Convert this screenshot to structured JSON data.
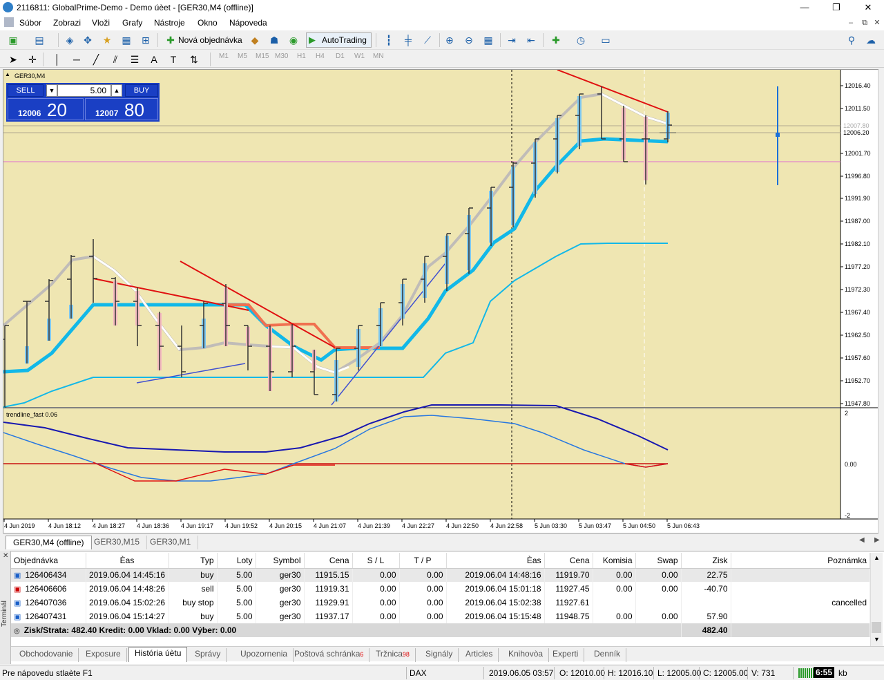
{
  "window": {
    "title": "2116811: GlobalPrime-Demo - Demo úèet - [GER30,M4 (offline)]",
    "minimize": "—",
    "restore": "❐",
    "close": "✕"
  },
  "menu": [
    "Súbor",
    "Zobrazi",
    "Vloži",
    "Grafy",
    "Nástroje",
    "Okno",
    "Nápoveda"
  ],
  "toolbar": {
    "new_order": "Nová objednávka",
    "autotrading": "AutoTrading",
    "timeframes": [
      "M1",
      "M5",
      "M15",
      "M30",
      "H1",
      "H4",
      "D1",
      "W1",
      "MN"
    ]
  },
  "chart": {
    "symbol_label": "GER30,M4",
    "indicator_label": "trendline_fast 0.06",
    "trade": {
      "sell_label": "SELL",
      "buy_label": "BUY",
      "lots": "5.00",
      "sell_price_small": "12006",
      "sell_price_big": "20",
      "buy_price_small": "12007",
      "buy_price_big": "80"
    },
    "price_axis": [
      "12016.40",
      "12011.50",
      "12006.20",
      "12001.70",
      "11996.80",
      "11991.90",
      "11987.00",
      "11982.10",
      "11977.20",
      "11972.30",
      "11967.40",
      "11962.50",
      "11957.60",
      "11952.70",
      "11947.80"
    ],
    "bid_tag": "12006.20",
    "ask_tag": "12007.80",
    "indicator_axis": [
      "2",
      "0.00",
      "-2"
    ],
    "time_axis": [
      "4 Jun 2019",
      "4 Jun 18:12",
      "4 Jun 18:27",
      "4 Jun 18:36",
      "4 Jun 19:17",
      "4 Jun 19:52",
      "4 Jun 20:15",
      "4 Jun 21:07",
      "4 Jun 21:39",
      "4 Jun 22:27",
      "4 Jun 22:50",
      "4 Jun 22:58",
      "5 Jun 03:30",
      "5 Jun 03:47",
      "5 Jun 04:50",
      "5 Jun 06:43"
    ]
  },
  "chart_tabs": [
    "GER30,M4 (offline)",
    "GER30,M15",
    "GER30,M1"
  ],
  "terminal": {
    "side_label": "Terminál",
    "columns": [
      "Objednávka",
      "Èas",
      "Typ",
      "Loty",
      "Symbol",
      "Cena",
      "S / L",
      "T / P",
      "Èas",
      "Cena",
      "Komisia",
      "Swap",
      "Zisk",
      "Poznámka"
    ],
    "rows": [
      {
        "order": "126406434",
        "open_time": "2019.06.04 14:45:16",
        "type": "buy",
        "lots": "5.00",
        "symbol": "ger30",
        "price": "11915.15",
        "sl": "0.00",
        "tp": "0.00",
        "close_time": "2019.06.04 14:48:16",
        "close_price": "11919.70",
        "commission": "0.00",
        "swap": "0.00",
        "profit": "22.75",
        "comment": ""
      },
      {
        "order": "126406606",
        "open_time": "2019.06.04 14:48:26",
        "type": "sell",
        "lots": "5.00",
        "symbol": "ger30",
        "price": "11919.31",
        "sl": "0.00",
        "tp": "0.00",
        "close_time": "2019.06.04 15:01:18",
        "close_price": "11927.45",
        "commission": "0.00",
        "swap": "0.00",
        "profit": "-40.70",
        "comment": ""
      },
      {
        "order": "126407036",
        "open_time": "2019.06.04 15:02:26",
        "type": "buy stop",
        "lots": "5.00",
        "symbol": "ger30",
        "price": "11929.91",
        "sl": "0.00",
        "tp": "0.00",
        "close_time": "2019.06.04 15:02:38",
        "close_price": "11927.61",
        "commission": "",
        "swap": "",
        "profit": "",
        "comment": "cancelled"
      },
      {
        "order": "126407431",
        "open_time": "2019.06.04 15:14:27",
        "type": "buy",
        "lots": "5.00",
        "symbol": "ger30",
        "price": "11937.17",
        "sl": "0.00",
        "tp": "0.00",
        "close_time": "2019.06.04 15:15:48",
        "close_price": "11948.75",
        "commission": "0.00",
        "swap": "0.00",
        "profit": "57.90",
        "comment": ""
      }
    ],
    "summary": "Zisk/Strata: 482.40  Kredit: 0.00  Vklad: 0.00  Výber: 0.00",
    "summary_total": "482.40",
    "tabs": [
      {
        "label": "Obchodovanie",
        "badge": ""
      },
      {
        "label": "Exposure",
        "badge": ""
      },
      {
        "label": "História úètu",
        "badge": ""
      },
      {
        "label": "Správy",
        "badge": ""
      },
      {
        "label": "Upozornenia",
        "badge": ""
      },
      {
        "label": "Poštová schránka",
        "badge": "6"
      },
      {
        "label": "Tržnica",
        "badge": "98"
      },
      {
        "label": "Signály",
        "badge": ""
      },
      {
        "label": "Articles",
        "badge": ""
      },
      {
        "label": "Knihovòa",
        "badge": ""
      },
      {
        "label": "Experti",
        "badge": ""
      },
      {
        "label": "Denník",
        "badge": ""
      }
    ]
  },
  "status": {
    "help": "Pre nápovedu stlaète F1",
    "profile": "DAX",
    "datetime": "2019.06.05 03:57",
    "open": "O: 12010.00",
    "high": "H: 12016.10",
    "low": "L: 12005.00",
    "close": "C: 12005.00",
    "volume": "V: 731",
    "conn_time": "6:55",
    "conn_unit": "kb"
  },
  "colors": {
    "chart_bg": "#efe6b2",
    "sell_blue": "#1a3fc4",
    "bear_candle": "#f4b9c0",
    "bull_candle": "#7ec8f0",
    "ma_cyan": "#12b8e8",
    "trend_red": "#e01010"
  }
}
